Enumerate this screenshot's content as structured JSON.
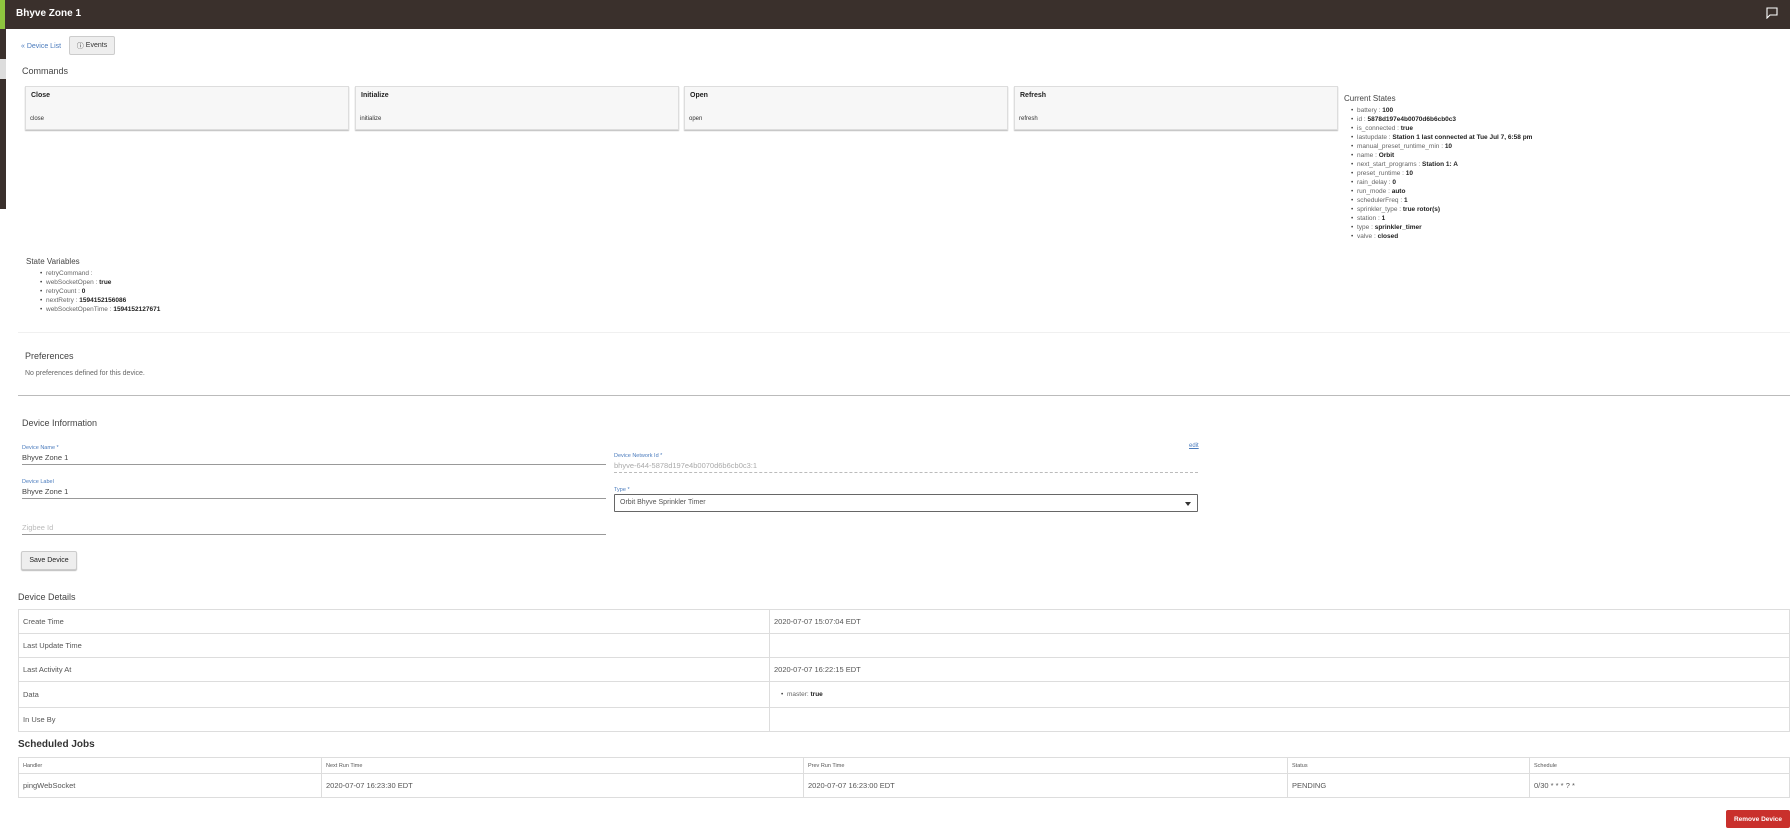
{
  "header": {
    "title": "Bhyve Zone 1",
    "icon": "feedback-icon"
  },
  "nav": {
    "device_list": "« Device List",
    "events": "Events"
  },
  "commands": {
    "title": "Commands",
    "items": [
      {
        "name": "Close",
        "arg": "close"
      },
      {
        "name": "Initialize",
        "arg": "initialize"
      },
      {
        "name": "Open",
        "arg": "open"
      },
      {
        "name": "Refresh",
        "arg": "refresh"
      }
    ]
  },
  "current_states": {
    "title": "Current States",
    "items": [
      {
        "key": "battery",
        "value": "100"
      },
      {
        "key": "id",
        "value": "5878d197e4b0070d6b6cb0c3"
      },
      {
        "key": "is_connected",
        "value": "true"
      },
      {
        "key": "lastupdate",
        "value": "Station 1 last connected at Tue Jul 7, 6:58 pm"
      },
      {
        "key": "manual_preset_runtime_min",
        "value": "10"
      },
      {
        "key": "name",
        "value": "Orbit"
      },
      {
        "key": "next_start_programs",
        "value": "Station 1: A"
      },
      {
        "key": "preset_runtime",
        "value": "10"
      },
      {
        "key": "rain_delay",
        "value": "0"
      },
      {
        "key": "run_mode",
        "value": "auto"
      },
      {
        "key": "schedulerFreq",
        "value": "1"
      },
      {
        "key": "sprinkler_type",
        "value": "true rotor(s)"
      },
      {
        "key": "station",
        "value": "1"
      },
      {
        "key": "type",
        "value": "sprinkler_timer"
      },
      {
        "key": "valve",
        "value": "closed"
      }
    ]
  },
  "state_variables": {
    "title": "State Variables",
    "items": [
      {
        "key": "retryCommand",
        "value": ""
      },
      {
        "key": "webSocketOpen",
        "value": "true"
      },
      {
        "key": "retryCount",
        "value": "0"
      },
      {
        "key": "nextRetry",
        "value": "1594152156086"
      },
      {
        "key": "webSocketOpenTime",
        "value": "1594152127671"
      }
    ]
  },
  "preferences": {
    "title": "Preferences",
    "text": "No preferences defined for this device."
  },
  "device_info": {
    "title": "Device Information",
    "name_label": "Device Name *",
    "name_value": "Bhyve Zone 1",
    "label_label": "Device Label",
    "label_value": "Bhyve Zone 1",
    "zigbee_placeholder": "Zigbee Id",
    "network_label": "Device Network Id *",
    "network_value": "bhyve-644-5878d197e4b0070d6b6cb0c3:1",
    "edit": "edit",
    "type_label": "Type *",
    "type_value": "Orbit Bhyve Sprinkler Timer",
    "save": "Save Device"
  },
  "device_details": {
    "title": "Device Details",
    "create_time_label": "Create Time",
    "create_time": "2020-07-07 15:07:04 EDT",
    "last_update_label": "Last Update Time",
    "last_update": "",
    "last_activity_label": "Last Activity At",
    "last_activity": "2020-07-07 16:22:15 EDT",
    "data_label": "Data",
    "data_key": "master",
    "data_value": "true",
    "in_use_label": "In Use By"
  },
  "scheduled_jobs": {
    "title": "Scheduled Jobs",
    "columns": [
      "Handler",
      "Next Run Time",
      "Prev Run Time",
      "Status",
      "Schedule"
    ],
    "rows": [
      [
        "pingWebSocket",
        "2020-07-07 16:23:30 EDT",
        "2020-07-07 16:23:00 EDT",
        "PENDING",
        "0/30 * * * ? *"
      ]
    ]
  },
  "remove_button": "Remove Device"
}
